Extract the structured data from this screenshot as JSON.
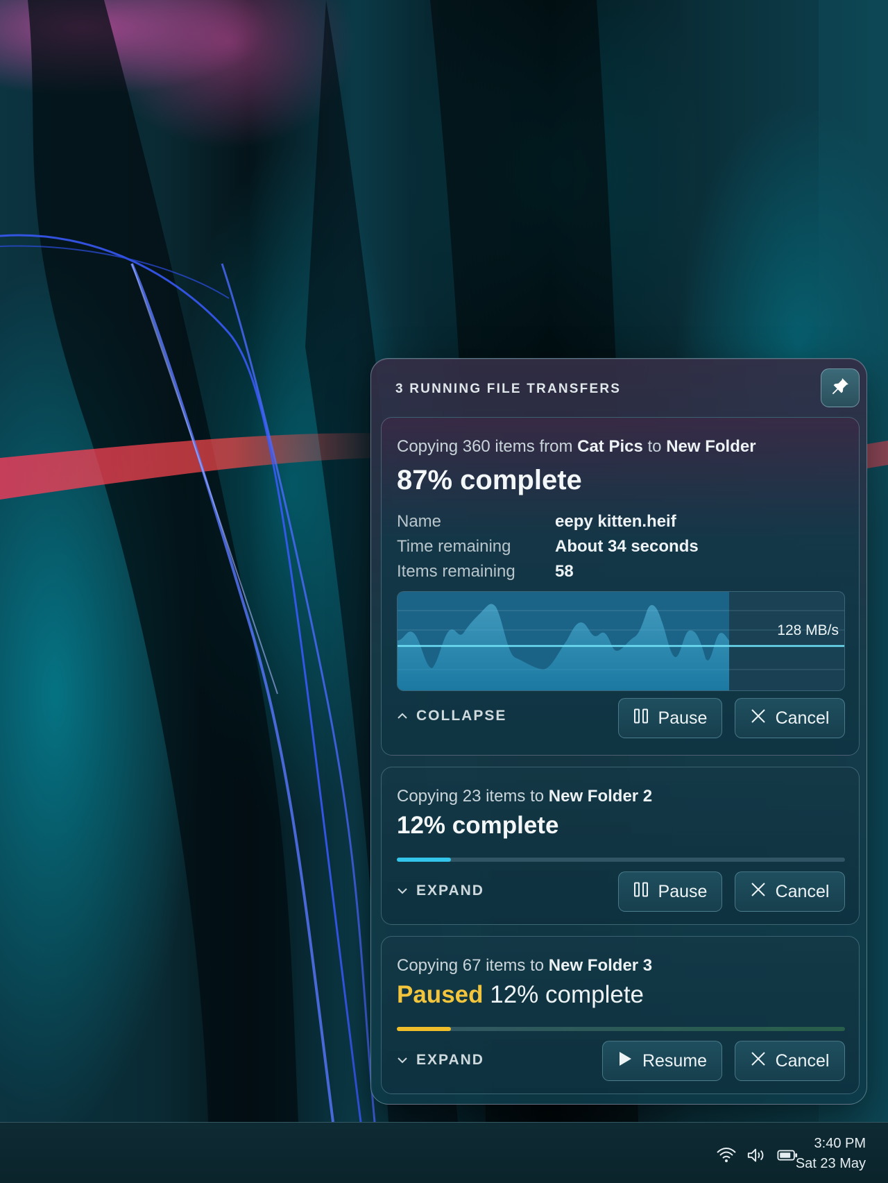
{
  "panel": {
    "title": "3 RUNNING FILE TRANSFERS",
    "pin_icon": "pin-icon"
  },
  "transfers": [
    {
      "desc_prefix": "Copying 360 items from ",
      "source": "Cat Pics",
      "desc_mid": " to ",
      "destination": "New Folder",
      "percent_text": "87% complete",
      "progress": 0.87,
      "details": [
        {
          "label": "Name",
          "value": "eepy kitten.heif"
        },
        {
          "label": "Time remaining",
          "value": "About 34 seconds"
        },
        {
          "label": "Items remaining",
          "value": "58"
        }
      ],
      "speed": "128 MB/s",
      "toggle": "COLLAPSE",
      "pause_label": "Pause",
      "cancel_label": "Cancel"
    },
    {
      "desc_prefix": "Copying 23 items to ",
      "destination": "New Folder 2",
      "percent_text": "12% complete",
      "progress": 0.12,
      "toggle": "EXPAND",
      "pause_label": "Pause",
      "cancel_label": "Cancel"
    },
    {
      "desc_prefix": "Copying 67 items to ",
      "destination": "New Folder 3",
      "status": "Paused",
      "percent_text": "12% complete",
      "progress": 0.12,
      "toggle": "EXPAND",
      "resume_label": "Resume",
      "cancel_label": "Cancel"
    }
  ],
  "taskbar": {
    "time": "3:40 PM",
    "date": "Sat 23 May",
    "icons": [
      "wifi-icon",
      "volume-icon",
      "battery-icon"
    ]
  },
  "colors": {
    "accent": "#33c6ea",
    "paused": "#f2c53d"
  }
}
